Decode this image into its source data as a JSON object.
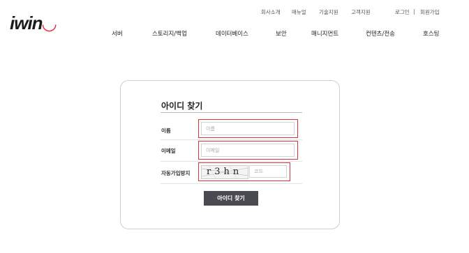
{
  "brand": {
    "name": "iwin"
  },
  "util_nav": [
    "회사소개",
    "매뉴얼",
    "기술지원",
    "고객지원",
    "로그인",
    "|",
    "회원가입"
  ],
  "main_nav": [
    "서버",
    "스토리지/백업",
    "데이터베이스",
    "보안",
    "매니지먼트",
    "컨텐츠/전송",
    "호스팅"
  ],
  "form": {
    "title": "아이디 찾기",
    "name_label": "이름",
    "name_placeholder": "이름",
    "email_label": "이메일",
    "email_placeholder": "이메일",
    "captcha_label": "자동가입방지",
    "captcha_text": "r3hn",
    "code_placeholder": "코드",
    "submit_label": "아이디 찾기"
  },
  "colors": {
    "accent": "#d9343a",
    "button": "#4a4a52",
    "logo_smile": "#e8314a"
  }
}
